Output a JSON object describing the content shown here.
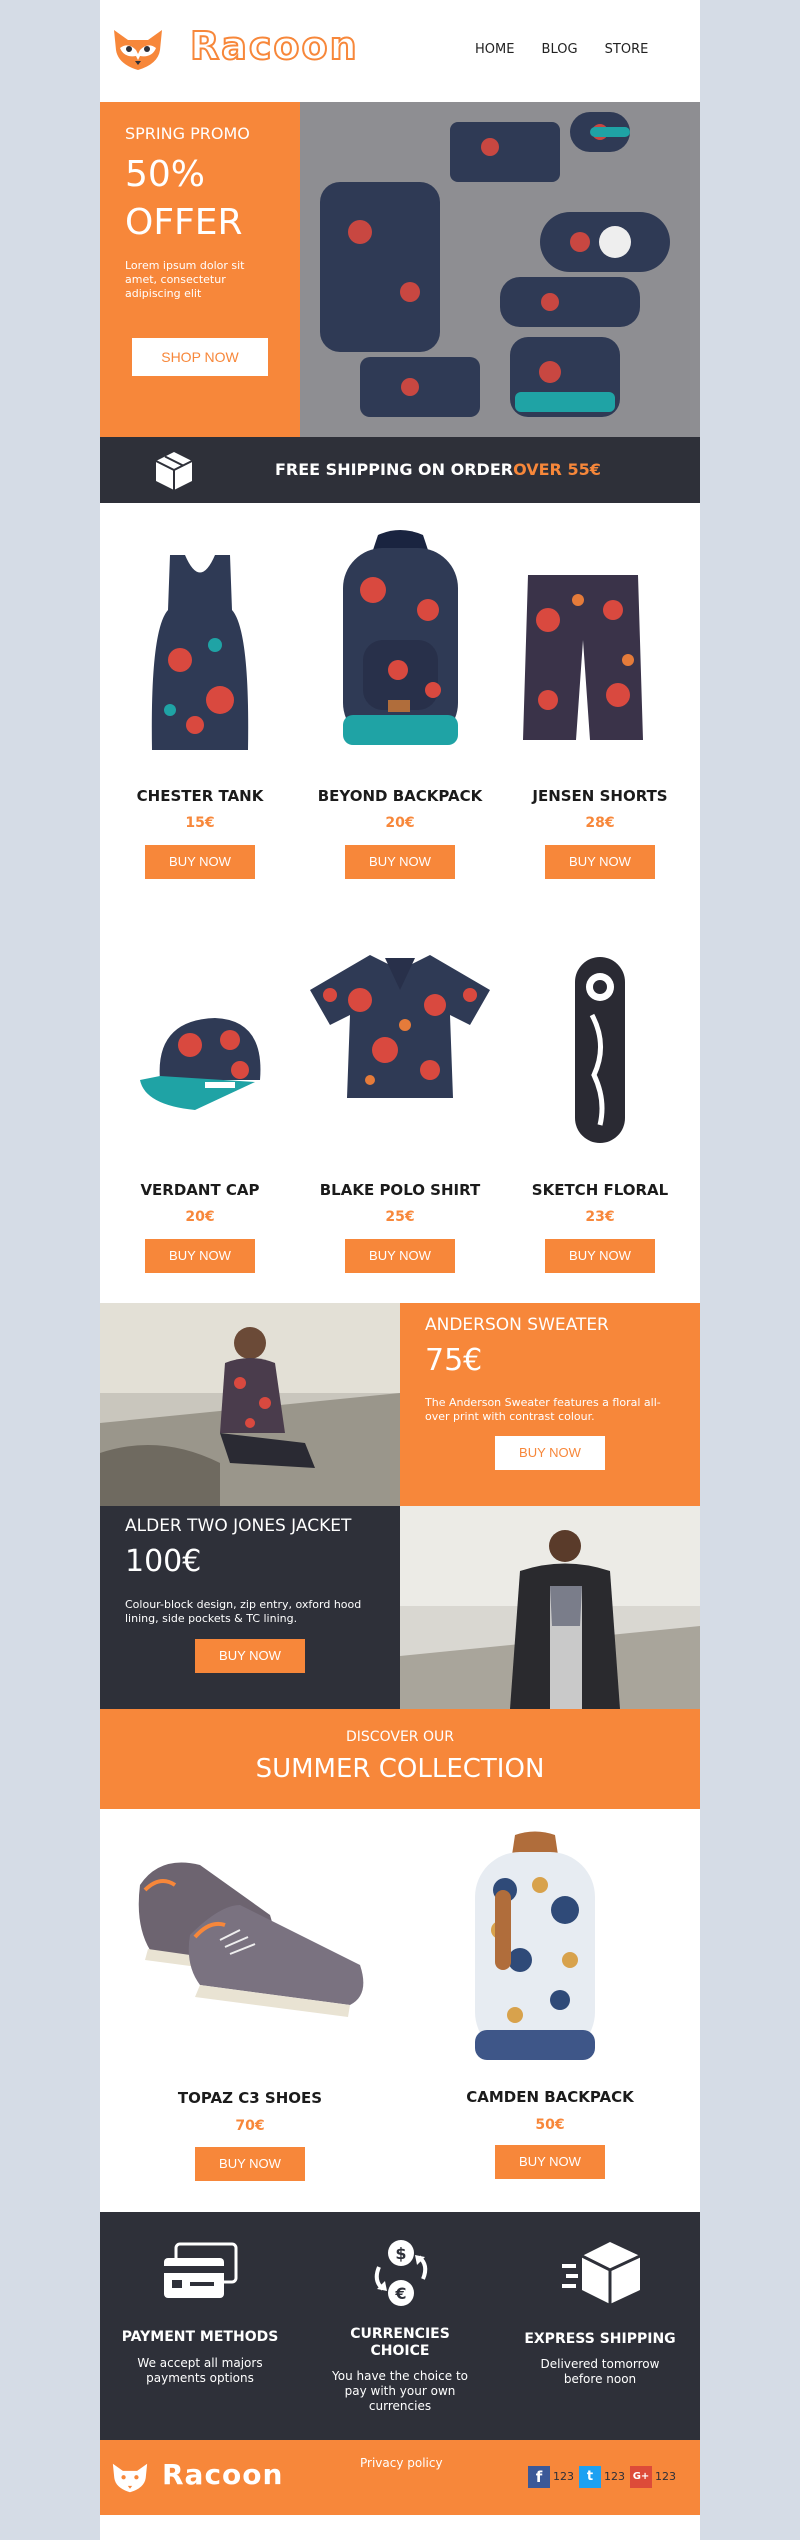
{
  "brand": {
    "name": "Racoon"
  },
  "nav": [
    {
      "label": "HOME"
    },
    {
      "label": "BLOG"
    },
    {
      "label": "STORE"
    }
  ],
  "hero": {
    "promo": "SPRING PROMO",
    "offer_line1": "50%",
    "offer_line2": "OFFER",
    "text": "Lorem ipsum dolor sit amet, consectetur adipiscing elit",
    "button": "SHOP NOW"
  },
  "shipping": {
    "text": "FREE SHIPPING ON ORDER",
    "highlight": "OVER 55€"
  },
  "products": [
    {
      "name": "CHESTER TANK",
      "price": "15€",
      "button": "BUY NOW"
    },
    {
      "name": "BEYOND BACKPACK",
      "price": "20€",
      "button": "BUY NOW"
    },
    {
      "name": "JENSEN SHORTS",
      "price": "28€",
      "button": "BUY NOW"
    },
    {
      "name": "VERDANT CAP",
      "price": "20€",
      "button": "BUY NOW"
    },
    {
      "name": "BLAKE POLO SHIRT",
      "price": "25€",
      "button": "BUY NOW"
    },
    {
      "name": "SKETCH FLORAL",
      "price": "23€",
      "button": "BUY NOW"
    }
  ],
  "feature1": {
    "title": "ANDERSON SWEATER",
    "price": "75€",
    "text": "The Anderson Sweater features a floral all-over print with contrast colour.",
    "button": "BUY NOW"
  },
  "feature2": {
    "title": "ALDER TWO JONES JACKET",
    "price": "100€",
    "text": "Colour-block design, zip entry, oxford hood lining, side pockets & TC lining.",
    "button": "BUY NOW"
  },
  "summer": {
    "kicker": "DISCOVER OUR",
    "title": "SUMMER COLLECTION"
  },
  "summer_products": [
    {
      "name": "TOPAZ C3 SHOES",
      "price": "70€",
      "button": "BUY NOW"
    },
    {
      "name": "CAMDEN BACKPACK",
      "price": "50€",
      "button": "BUY NOW"
    }
  ],
  "benefits": [
    {
      "title": "PAYMENT METHODS",
      "text": "We accept all majors payments options"
    },
    {
      "title": "CURRENCIES CHOICE",
      "text": "You have the choice to pay with your own currencies"
    },
    {
      "title": "EXPRESS SHIPPING",
      "text": "Delivered tomorrow before noon"
    }
  ],
  "footer": {
    "privacy": "Privacy policy",
    "social": [
      {
        "count": "123"
      },
      {
        "count": "123"
      },
      {
        "count": "123"
      }
    ]
  },
  "colors": {
    "accent": "#f7873a",
    "dark": "#2e3039",
    "bg": "#d5dce6"
  }
}
